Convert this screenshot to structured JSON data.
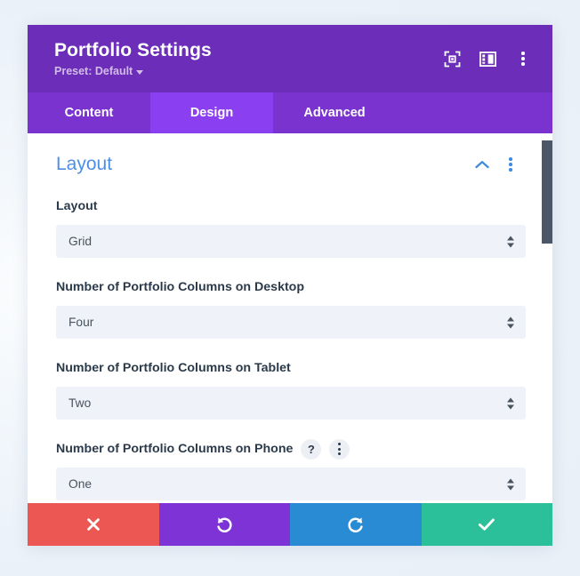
{
  "window": {
    "title": "Portfolio Settings",
    "preset_label": "Preset: Default",
    "header_icons": [
      {
        "name": "focus-icon",
        "label": "Focus"
      },
      {
        "name": "layout-panel-icon",
        "label": "Layout"
      },
      {
        "name": "more-options-icon",
        "label": "More options"
      }
    ]
  },
  "tabs": [
    {
      "label": "Content",
      "active": false
    },
    {
      "label": "Design",
      "active": true
    },
    {
      "label": "Advanced",
      "active": false
    }
  ],
  "section": {
    "title": "Layout",
    "collapse_icon": "chevron-up-icon",
    "options_icon": "more-options-icon"
  },
  "fields": [
    {
      "label": "Layout",
      "value": "Grid",
      "help": false,
      "options_menu": false
    },
    {
      "label": "Number of Portfolio Columns on Desktop",
      "value": "Four",
      "help": false,
      "options_menu": false
    },
    {
      "label": "Number of Portfolio Columns on Tablet",
      "value": "Two",
      "help": false,
      "options_menu": false
    },
    {
      "label": "Number of Portfolio Columns on Phone",
      "value": "One",
      "help": true,
      "help_glyph": "?",
      "options_menu": true
    }
  ],
  "footer": {
    "buttons": [
      {
        "name": "cancel-button",
        "icon": "close-icon",
        "color": "#ec5653"
      },
      {
        "name": "undo-button",
        "icon": "undo-icon",
        "color": "#7d33d6"
      },
      {
        "name": "redo-button",
        "icon": "redo-icon",
        "color": "#2a8bd5"
      },
      {
        "name": "save-button",
        "icon": "check-icon",
        "color": "#2bbf9a"
      }
    ]
  },
  "colors": {
    "header_purple": "#6c2eb9",
    "tabbar_purple": "#7b33cf",
    "tab_active_purple": "#8a3ff0",
    "section_title_blue": "#4c8ee8",
    "field_bg": "#eff2f8",
    "scrollbar_thumb": "#4b5668"
  }
}
